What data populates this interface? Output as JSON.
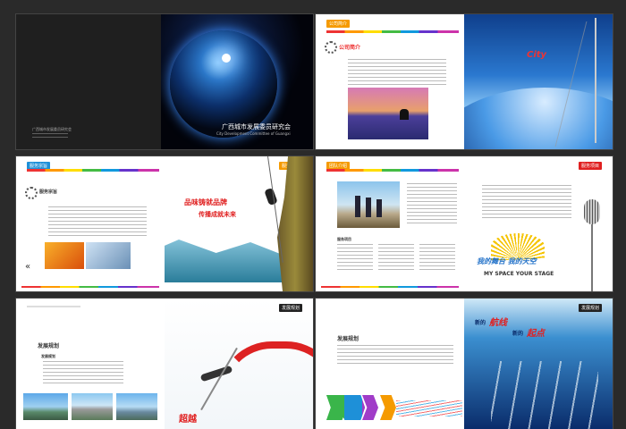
{
  "spread1": {
    "org_cn": "广西城市发展委员研究会",
    "org_en": "City Development Committee of Guangxi",
    "small_cover_text": "广西城市发展委员研究会"
  },
  "spread2": {
    "tag": "公司简介",
    "heading": "公司简介",
    "brand_en": "City"
  },
  "spread3": {
    "tag_left": "服务宗旨",
    "tag_right": "服务宗旨",
    "heading": "服务宗旨",
    "slogan_line1": "品味铸就品牌",
    "slogan_line2": "传播成就未来"
  },
  "spread4": {
    "tag_left": "团队介绍",
    "tag_right": "服务项目",
    "list_heading": "服务项目",
    "stage_cn": "我的舞台 我的天空",
    "stage_en": "MY SPACE YOUR STAGE"
  },
  "spread5": {
    "tag_right": "发展规划",
    "heading": "发展规划",
    "sub_heading": "发展规划",
    "chao": "超越"
  },
  "spread6": {
    "tag_right": "发展规划",
    "heading": "发展规划",
    "banner_1": "新的",
    "banner_2": "航线",
    "banner_3": "新的",
    "banner_4": "起点"
  },
  "colors": {
    "red": "#e02020",
    "orange": "#f59a00",
    "deep_blue": "#0a2c6b"
  }
}
